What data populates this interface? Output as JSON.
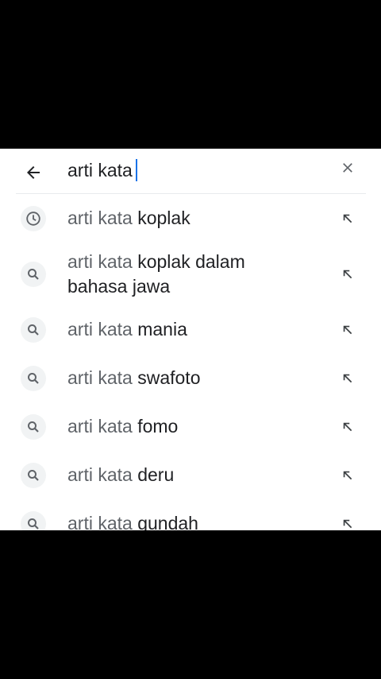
{
  "search": {
    "query": "arti kata"
  },
  "suggestions": [
    {
      "type": "history-icon",
      "prefix": "arti kata",
      "rest": "koplak",
      "rest2": ""
    },
    {
      "type": "search-icon",
      "prefix": "arti kata",
      "rest": "koplak dalam",
      "rest2": "bahasa jawa"
    },
    {
      "type": "search-icon",
      "prefix": "arti kata",
      "rest": "mania",
      "rest2": ""
    },
    {
      "type": "search-icon",
      "prefix": "arti kata",
      "rest": "swafoto",
      "rest2": ""
    },
    {
      "type": "search-icon",
      "prefix": "arti kata",
      "rest": "fomo",
      "rest2": ""
    },
    {
      "type": "search-icon",
      "prefix": "arti kata",
      "rest": "deru",
      "rest2": ""
    },
    {
      "type": "search-icon",
      "prefix": "arti kata",
      "rest": "gundah",
      "rest2": ""
    }
  ],
  "colors": {
    "text": "#202124",
    "muted": "#5f6368",
    "caret": "#1a73e8",
    "icon_bg": "#f1f3f4"
  }
}
